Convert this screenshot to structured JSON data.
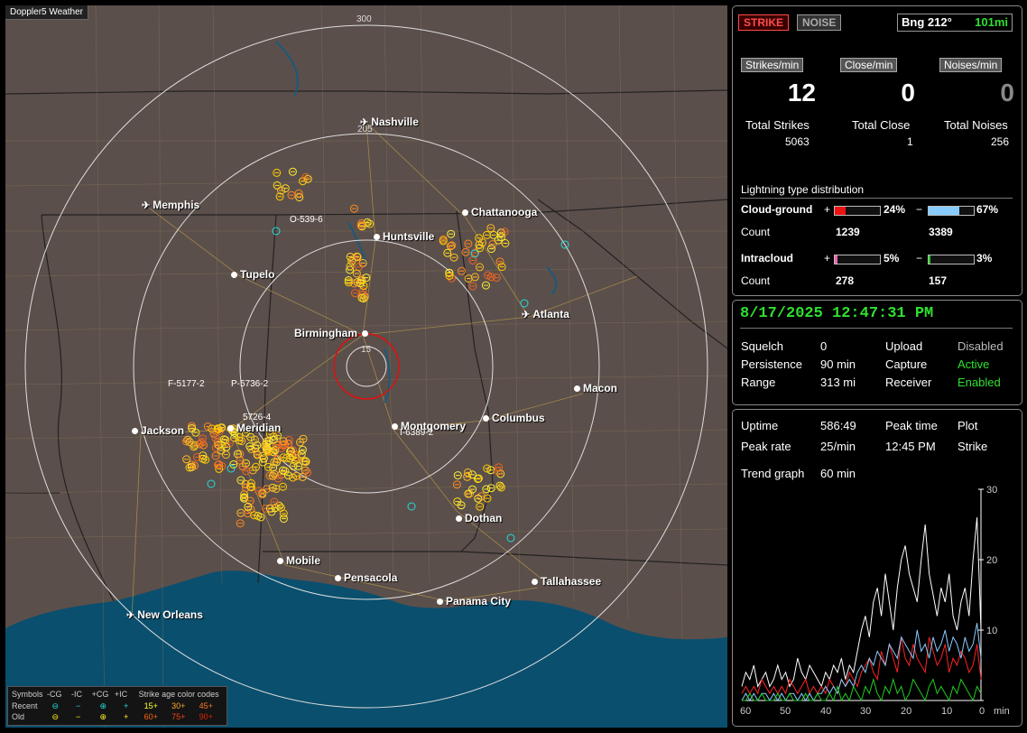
{
  "app_title": "Doppler5 Weather",
  "map": {
    "ring_labels": {
      "north": "300",
      "middle": "205",
      "inner": "15"
    },
    "cities": [
      {
        "name": "Nashville",
        "icon": "plane-icon"
      },
      {
        "name": "Memphis",
        "icon": "plane-icon"
      },
      {
        "name": "Chattanooga",
        "icon": "dot"
      },
      {
        "name": "Huntsville",
        "icon": "dot"
      },
      {
        "name": "Tupelo",
        "icon": "dot"
      },
      {
        "name": "Atlanta",
        "icon": "plane-icon"
      },
      {
        "name": "Birmingham",
        "icon": "dot"
      },
      {
        "name": "Macon",
        "icon": "dot"
      },
      {
        "name": "Jackson",
        "icon": "dot"
      },
      {
        "name": "Meridian",
        "icon": "dot"
      },
      {
        "name": "Montgomery",
        "icon": "dot"
      },
      {
        "name": "Columbus",
        "icon": "dot"
      },
      {
        "name": "Dothan",
        "icon": "dot"
      },
      {
        "name": "Mobile",
        "icon": "dot"
      },
      {
        "name": "Pensacola",
        "icon": "dot"
      },
      {
        "name": "Tallahassee",
        "icon": "dot"
      },
      {
        "name": "Panama City",
        "icon": "dot"
      },
      {
        "name": "New Orleans",
        "icon": "plane-icon"
      }
    ],
    "storm_labels": [
      "O-539-6",
      "F-5177-2",
      "P-5736-2",
      "5726-4",
      "I-6389-2"
    ],
    "legend": {
      "symbols_label": "Symbols",
      "col_neg_cg": "-CG",
      "col_neg_ic": "-IC",
      "col_pos_cg": "+CG",
      "col_pos_ic": "+IC",
      "age_title": "Strike age color codes",
      "recent_label": "Recent",
      "old_label": "Old",
      "ages_recent": [
        "15+",
        "30+",
        "45+"
      ],
      "ages_old": [
        "60+",
        "75+",
        "90+"
      ],
      "age_colors": [
        "#ffff33",
        "#ffaa22",
        "#ff7722",
        "#ff6611",
        "#ee4411",
        "#dd2200"
      ]
    }
  },
  "panel_top": {
    "strike_label": "STRIKE",
    "noise_label": "NOISE",
    "bearing": "Bng 212°",
    "distance": "101mi",
    "rates": [
      {
        "label": "Strikes/min",
        "value": "12"
      },
      {
        "label": "Close/min",
        "value": "0"
      },
      {
        "label": "Noises/min",
        "value": "0"
      }
    ],
    "totals": [
      {
        "label": "Total Strikes",
        "value": "5063"
      },
      {
        "label": "Total Close",
        "value": "1"
      },
      {
        "label": "Total Noises",
        "value": "256"
      }
    ],
    "dist_title": "Lightning type distribution",
    "cloud_ground_label": "Cloud-ground",
    "intracloud_label": "Intracloud",
    "count_label": "Count",
    "plus": "+",
    "minus": "−",
    "cg_pos_pct": "24%",
    "cg_neg_pct": "67%",
    "cg_pos_count": "1239",
    "cg_neg_count": "3389",
    "ic_pos_pct": "5%",
    "ic_neg_pct": "3%",
    "ic_pos_count": "278",
    "ic_neg_count": "157",
    "cg_pos_fill": 0.24,
    "cg_neg_fill": 0.67,
    "ic_pos_fill": 0.05,
    "ic_neg_fill": 0.03
  },
  "panel_status": {
    "datetime": "8/17/2025 12:47:31 PM",
    "squelch_label": "Squelch",
    "squelch": "0",
    "persistence_label": "Persistence",
    "persistence": "90 min",
    "range_label": "Range",
    "range": "313 mi",
    "upload_label": "Upload",
    "upload": "Disabled",
    "capture_label": "Capture",
    "capture": "Active",
    "receiver_label": "Receiver",
    "receiver": "Enabled"
  },
  "panel_trend": {
    "uptime_label": "Uptime",
    "uptime": "586:49",
    "peak_time_label": "Peak time",
    "plot_label": "Plot",
    "peak_rate_label": "Peak rate",
    "peak_rate": "25/min",
    "peak_time": "12:45 PM",
    "plot": "Strike",
    "trend_label": "Trend graph",
    "trend": "60 min",
    "y_ticks": [
      "30",
      "20",
      "10"
    ],
    "x_ticks": [
      "60",
      "50",
      "40",
      "30",
      "20",
      "10",
      "0"
    ],
    "x_unit": "min"
  },
  "chart_data": {
    "type": "line",
    "ylim": [
      0,
      30
    ],
    "xlabel": "min",
    "x": [
      60,
      59,
      58,
      57,
      56,
      55,
      54,
      53,
      52,
      51,
      50,
      49,
      48,
      47,
      46,
      45,
      44,
      43,
      42,
      41,
      40,
      39,
      38,
      37,
      36,
      35,
      34,
      33,
      32,
      31,
      30,
      29,
      28,
      27,
      26,
      25,
      24,
      23,
      22,
      21,
      20,
      19,
      18,
      17,
      16,
      15,
      14,
      13,
      12,
      11,
      10,
      9,
      8,
      7,
      6,
      5,
      4,
      3,
      2,
      1,
      0
    ],
    "series": [
      {
        "color": "#ffffff",
        "values": [
          2,
          4,
          3,
          5,
          2,
          3,
          4,
          2,
          3,
          5,
          3,
          4,
          2,
          3,
          6,
          4,
          3,
          5,
          4,
          3,
          2,
          4,
          3,
          5,
          4,
          6,
          3,
          5,
          4,
          7,
          10,
          12,
          9,
          14,
          16,
          12,
          18,
          14,
          10,
          16,
          20,
          22,
          18,
          16,
          14,
          20,
          25,
          18,
          15,
          12,
          16,
          14,
          18,
          12,
          10,
          14,
          16,
          12,
          20,
          26,
          10
        ]
      },
      {
        "color": "#ff2222",
        "values": [
          1,
          2,
          1,
          2,
          1,
          3,
          2,
          1,
          2,
          1,
          2,
          1,
          3,
          2,
          1,
          2,
          3,
          1,
          2,
          1,
          2,
          1,
          3,
          2,
          1,
          3,
          2,
          4,
          3,
          2,
          4,
          5,
          6,
          4,
          3,
          7,
          5,
          8,
          6,
          4,
          9,
          6,
          5,
          8,
          6,
          5,
          4,
          9,
          7,
          5,
          6,
          8,
          4,
          6,
          5,
          7,
          6,
          4,
          5,
          8,
          3
        ]
      },
      {
        "color": "#88ccff",
        "values": [
          0,
          1,
          0,
          1,
          0,
          1,
          1,
          0,
          1,
          0,
          1,
          0,
          1,
          1,
          0,
          1,
          0,
          1,
          0,
          1,
          1,
          2,
          1,
          2,
          1,
          3,
          2,
          3,
          2,
          4,
          5,
          4,
          6,
          5,
          7,
          6,
          5,
          8,
          7,
          6,
          9,
          8,
          7,
          6,
          10,
          7,
          8,
          6,
          9,
          7,
          8,
          10,
          7,
          9,
          8,
          6,
          9,
          7,
          8,
          11,
          6
        ]
      },
      {
        "color": "#22cc22",
        "values": [
          0,
          0,
          1,
          0,
          0,
          1,
          0,
          0,
          0,
          1,
          0,
          0,
          1,
          0,
          0,
          0,
          1,
          0,
          0,
          1,
          0,
          0,
          1,
          0,
          2,
          0,
          1,
          0,
          2,
          1,
          0,
          2,
          1,
          3,
          1,
          0,
          2,
          1,
          3,
          1,
          2,
          0,
          1,
          3,
          2,
          1,
          0,
          2,
          3,
          1,
          2,
          1,
          0,
          2,
          1,
          3,
          2,
          1,
          0,
          2,
          1
        ]
      }
    ]
  }
}
